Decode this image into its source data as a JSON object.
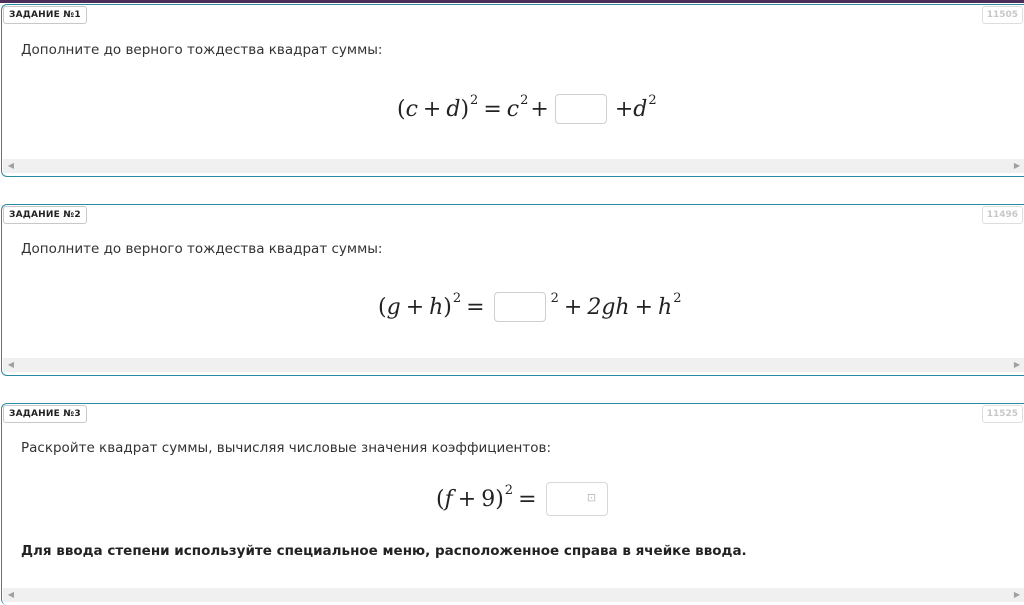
{
  "tasks": [
    {
      "badge": "ЗАДАНИЕ №1",
      "id": "11505",
      "prompt": "Дополните до верного тождества квадрат суммы:",
      "formula": {
        "open": "(",
        "a": "c",
        "plus": "+",
        "b": "d",
        "close": ")",
        "exp": "2",
        "eq": "=",
        "t1": "c",
        "t1exp": "2",
        "plus2": "+",
        "plus3": "+",
        "t3": "d",
        "t3exp": "2",
        "answer_value": ""
      }
    },
    {
      "badge": "ЗАДАНИЕ №2",
      "id": "11496",
      "prompt": "Дополните до верного тождества квадрат суммы:",
      "formula": {
        "open": "(",
        "a": "g",
        "plus": "+",
        "b": "h",
        "close": ")",
        "exp": "2",
        "eq": "=",
        "boxexp": "2",
        "plus2": "+",
        "mid": "2gh",
        "plus3": "+",
        "t3": "h",
        "t3exp": "2",
        "answer_value": ""
      }
    },
    {
      "badge": "ЗАДАНИЕ №3",
      "id": "11525",
      "prompt": "Раскройте квадрат суммы, вычисляя числовые значения коэффициентов:",
      "formula": {
        "open": "(",
        "a": "f",
        "plus": "+",
        "b": "9",
        "close": ")",
        "exp": "2",
        "eq": "=",
        "menu_icon": "power-menu-icon",
        "answer_value": ""
      },
      "note": "Для ввода степени используйте специальное меню, расположенное справа в ячейке ввода."
    }
  ],
  "scroll": {
    "left_arrow": "◀",
    "right_arrow": "▶"
  },
  "colors": {
    "border": "#2b8aa3",
    "topline": "#4b2f5a"
  }
}
